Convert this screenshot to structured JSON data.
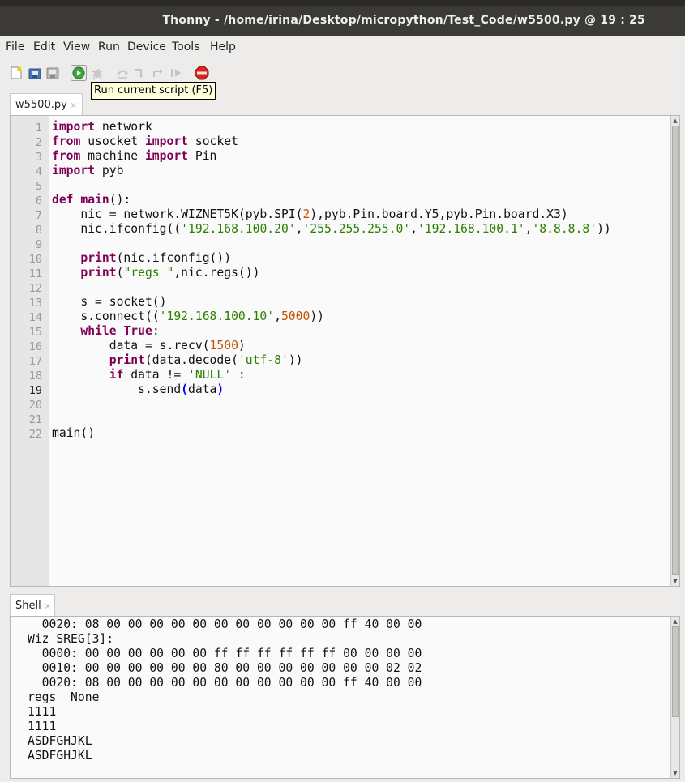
{
  "window": {
    "title": "Thonny  -  /home/irina/Desktop/micropython/Test_Code/w5500.py  @  19 : 25"
  },
  "menu": {
    "items": [
      "File",
      "Edit",
      "View",
      "Run",
      "Device",
      "Tools",
      "Help"
    ]
  },
  "toolbar": {
    "tooltip": "Run current script (F5)",
    "buttons": [
      "new-file-icon",
      "open-file-icon",
      "save-file-icon",
      "run-icon",
      "debug-icon",
      "step-over-icon",
      "step-into-icon",
      "step-out-icon",
      "resume-icon",
      "stop-icon"
    ]
  },
  "editor": {
    "tab_label": "w5500.py",
    "tab_close": "×",
    "current_line": 19,
    "line_numbers": [
      "1",
      "2",
      "3",
      "4",
      "5",
      "6",
      "7",
      "8",
      "9",
      "10",
      "11",
      "12",
      "13",
      "14",
      "15",
      "16",
      "17",
      "18",
      "19",
      "20",
      "21",
      "22"
    ],
    "code": {
      "l1": [
        "import",
        " network"
      ],
      "l2": [
        "from",
        " usocket ",
        "import",
        " socket"
      ],
      "l3": [
        "from",
        " machine ",
        "import",
        " Pin"
      ],
      "l4": [
        "import",
        " pyb"
      ],
      "l6": [
        "def",
        " ",
        "main",
        "():"
      ],
      "l7": [
        "    nic = network.WIZNET5K(pyb.SPI(",
        "2",
        "),pyb.Pin.board.Y5,pyb.Pin.board.X3)"
      ],
      "l8": [
        "    nic.ifconfig((",
        "'192.168.100.20'",
        ",",
        "'255.255.255.0'",
        ",",
        "'192.168.100.1'",
        ",",
        "'8.8.8.8'",
        "))"
      ],
      "l10": [
        "    ",
        "print",
        "(nic.ifconfig())"
      ],
      "l11": [
        "    ",
        "print",
        "(",
        "\"regs \"",
        ",nic.regs())"
      ],
      "l13": [
        "    s = socket()"
      ],
      "l14": [
        "    s.connect((",
        "'192.168.100.10'",
        ",",
        "5000",
        "))"
      ],
      "l15": [
        "    ",
        "while",
        " ",
        "True",
        ":"
      ],
      "l16": [
        "        data = s.recv(",
        "1500",
        ")"
      ],
      "l17": [
        "        ",
        "print",
        "(data.decode(",
        "'utf-8'",
        "))"
      ],
      "l18": [
        "        ",
        "if",
        " data != ",
        "'NULL'",
        " :"
      ],
      "l19": [
        "            s.send",
        "(",
        "data",
        ")"
      ],
      "l22": [
        "main()"
      ]
    }
  },
  "shell": {
    "tab_label": "Shell",
    "tab_close": "×",
    "lines": [
      "  0020: 08 00 00 00 00 00 00 00 00 00 00 00 ff 40 00 00",
      "Wiz SREG[3]:",
      "  0000: 00 00 00 00 00 00 ff ff ff ff ff ff 00 00 00 00",
      "  0010: 00 00 00 00 00 00 80 00 00 00 00 00 00 00 02 02",
      "  0020: 08 00 00 00 00 00 00 00 00 00 00 00 ff 40 00 00",
      "regs  None",
      "1111",
      "1111",
      "ASDFGHJKL",
      "ASDFGHJKL"
    ]
  }
}
